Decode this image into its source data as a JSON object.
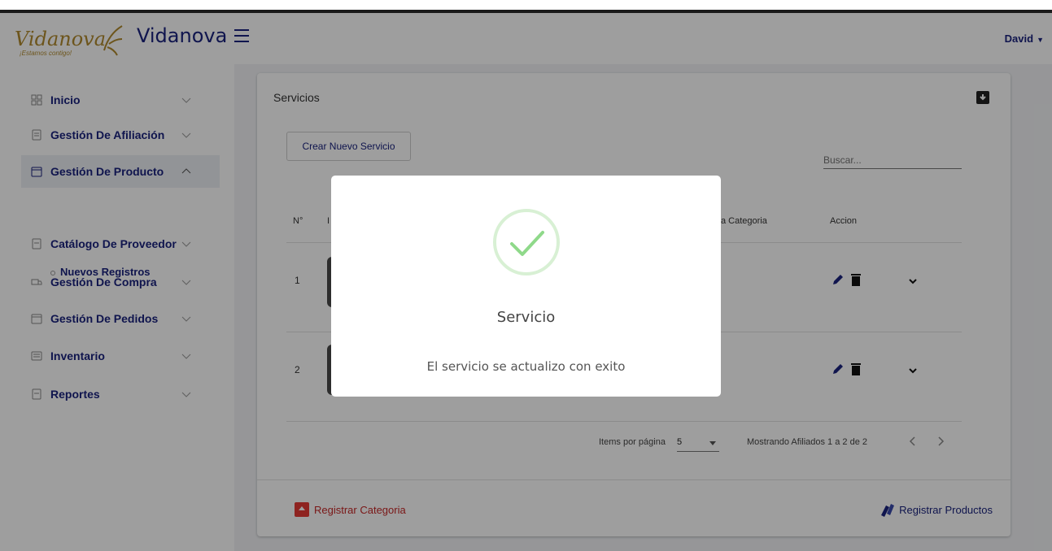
{
  "header": {
    "logo_text": "Vidanova",
    "logo_tagline": "¡Estamos contigo!",
    "brand": "Vidanova",
    "user": "David"
  },
  "sidebar": {
    "items": [
      {
        "label": "Inicio",
        "icon": "grid-icon",
        "chevron": "chevron-down"
      },
      {
        "label": "Gestión De Afiliación",
        "icon": "document-list-icon",
        "chevron": "chevron-down"
      },
      {
        "label": "Gestión De Producto",
        "icon": "calendar-icon",
        "chevron": "chevron-up"
      },
      {
        "label": "Catálogo De Proveedor",
        "icon": "document-icon",
        "chevron": "chevron-down"
      },
      {
        "label": "Gestión De Compra",
        "icon": "truck-icon",
        "chevron": "chevron-down"
      },
      {
        "label": "Gestión De Pedidos",
        "icon": "calendar-icon",
        "chevron": "chevron-down"
      },
      {
        "label": "Inventario",
        "icon": "list-icon",
        "chevron": "chevron-down"
      },
      {
        "label": "Reportes",
        "icon": "document-icon",
        "chevron": "chevron-down"
      }
    ],
    "sub_item": "Nuevos Registros"
  },
  "card": {
    "title": "Servicios",
    "create_button": "Crear Nuevo Servicio",
    "search_placeholder": "Buscar...",
    "columns": {
      "num": "N°",
      "img": "I",
      "category": "a Categoria",
      "action": "Accion"
    },
    "rows": [
      {
        "num": "1"
      },
      {
        "num": "2"
      }
    ],
    "paginator": {
      "items_label": "Items por página",
      "page_size": "5",
      "range": "Mostrando Afiliados 1 a 2 de 2"
    },
    "footer": {
      "register_category": "Registrar Categoria",
      "register_products": "Registrar Productos"
    }
  },
  "modal": {
    "title": "Servicio",
    "message": "El servicio se actualizo con exito"
  },
  "colors": {
    "primary": "#1a237e",
    "danger": "#c62828",
    "success": "#8fd98a"
  }
}
